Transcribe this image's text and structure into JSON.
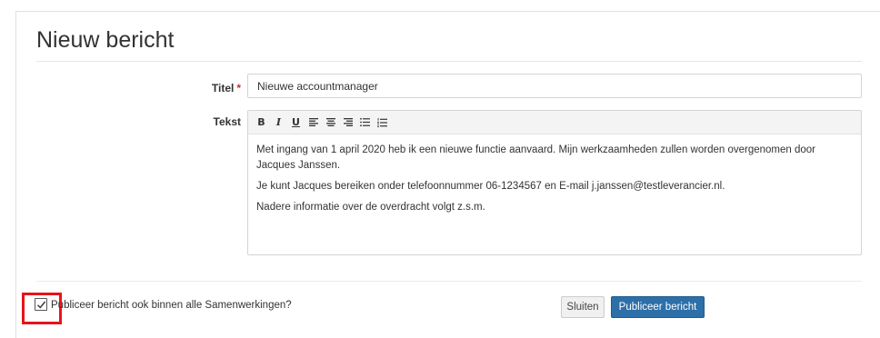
{
  "page": {
    "title": "Nieuw bericht"
  },
  "form": {
    "titel_label": "Titel",
    "required_marker": "*",
    "titel_value": "Nieuwe accountmanager",
    "tekst_label": "Tekst"
  },
  "editor": {
    "toolbar": [
      {
        "label": "B",
        "icon": "bold-icon"
      },
      {
        "label": "I",
        "icon": "italic-icon"
      },
      {
        "label": "U",
        "icon": "underline-icon"
      },
      {
        "icon": "align-left-icon"
      },
      {
        "icon": "align-center-icon"
      },
      {
        "icon": "align-right-icon"
      },
      {
        "icon": "bullet-list-icon"
      },
      {
        "icon": "numbered-list-icon"
      }
    ],
    "paragraphs": [
      "Met ingang van 1 april 2020 heb ik een nieuwe functie aanvaard. Mijn werkzaamheden zullen worden overgenomen door Jacques Janssen.",
      "Je kunt Jacques bereiken onder telefoonnummer 06-1234567 en E-mail j.janssen@testleverancier.nl.",
      "Nadere informatie over de overdracht volgt z.s.m."
    ]
  },
  "footer": {
    "checkbox_checked": true,
    "checkbox_label": "Publiceer bericht ook binnen alle Samenwerkingen?",
    "close_label": "Sluiten",
    "publish_label": "Publiceer bericht",
    "highlight_color": "#e8141b",
    "primary_color": "#2d6fa8"
  }
}
